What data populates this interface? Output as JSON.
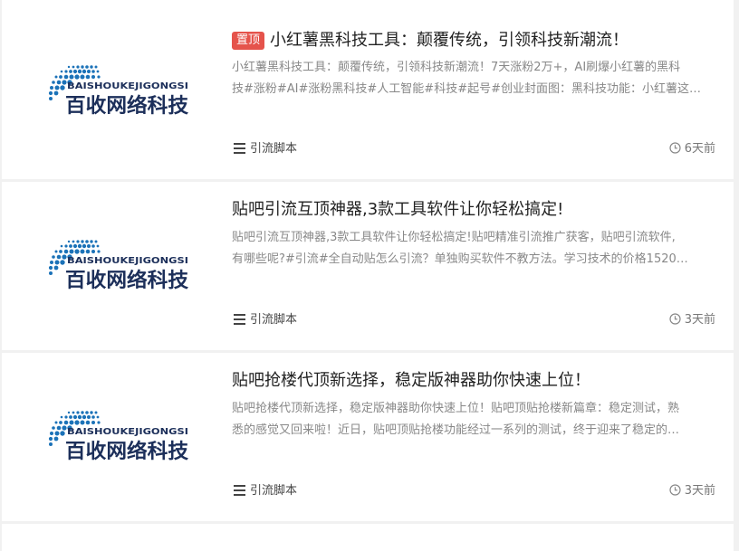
{
  "posts": [
    {
      "badge": "置顶",
      "title": "小红薯黑科技工具：颠覆传统，引领科技新潮流！",
      "excerpt_line1": "小红薯黑科技工具：颠覆传统，引领科技新潮流！7天涨粉2万+，AI刷爆小红薯的黑科",
      "excerpt_line2": "技#涨粉#AI#涨粉黑科技#人工智能#科技#起号#创业封面图：黑科技功能：小红薯这…",
      "category": "引流脚本",
      "time": "6天前",
      "logo_latin": "BAISHOUKEJIGONGSI",
      "logo_cn": "百收网络科技"
    },
    {
      "title": "贴吧引流互顶神器,3款工具软件让你轻松搞定!",
      "excerpt_line1": "贴吧引流互顶神器,3款工具软件让你轻松搞定!贴吧精准引流推广获客，贴吧引流软件,",
      "excerpt_line2": "有哪些呢?#引流#全自动贴怎么引流？单独购买软件不教方法。学习技术的价格1520…",
      "category": "引流脚本",
      "time": "3天前",
      "logo_latin": "BAISHOUKEJIGONGSI",
      "logo_cn": "百收网络科技"
    },
    {
      "title": "贴吧抢楼代顶新选择，稳定版神器助你快速上位！",
      "excerpt_line1": "贴吧抢楼代顶新选择，稳定版神器助你快速上位！贴吧顶贴抢楼新篇章：稳定测试，熟",
      "excerpt_line2": "悉的感觉又回来啦！近日，贴吧顶贴抢楼功能经过一系列的测试，终于迎来了稳定的…",
      "category": "引流脚本",
      "time": "3天前",
      "logo_latin": "BAISHOUKEJIGONGSI",
      "logo_cn": "百收网络科技"
    }
  ],
  "colors": {
    "badge": "#e5534b",
    "logo_blue": "#1b72b8",
    "logo_dark": "#1c2f5a"
  }
}
